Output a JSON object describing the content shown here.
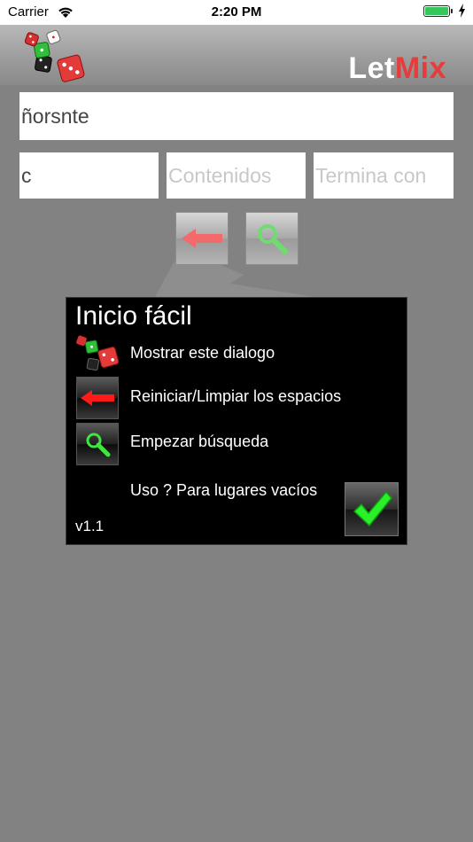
{
  "status_bar": {
    "carrier": "Carrier",
    "time": "2:20 PM"
  },
  "header": {
    "brand_part1": "Let",
    "brand_part2": "Mix",
    "brand_color": "#e83b3b"
  },
  "search": {
    "letters_value": "ñorsnte",
    "starts_with_value": "c",
    "contains_placeholder": "Contenidos",
    "ends_with_placeholder": "Termina con"
  },
  "dialog": {
    "title": "Inicio fácil",
    "items": [
      {
        "icon": "dice-logo-icon",
        "label": "Mostrar este dialogo"
      },
      {
        "icon": "red-arrow-left-icon",
        "label": "Reiniciar/Limpiar los espacios"
      },
      {
        "icon": "magnifier-icon",
        "label": "Empezar búsqueda"
      },
      {
        "icon": "",
        "label": "Uso ? Para lugares vacíos"
      }
    ],
    "version": "v1.1",
    "ok_icon": "green-check-icon"
  }
}
